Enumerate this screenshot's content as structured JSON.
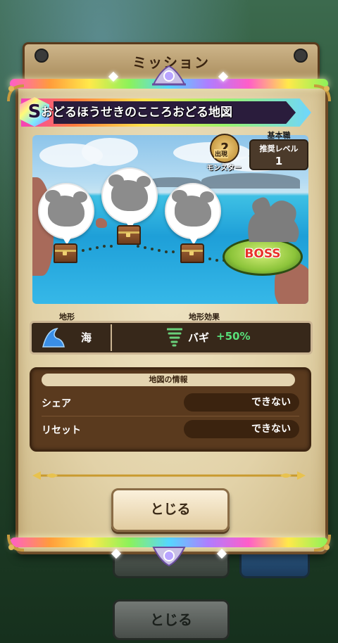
{
  "background": {
    "mission_title": "ミッション",
    "close_label": "とじる"
  },
  "title": {
    "rank": "S",
    "text": "おどるほうせきのこころおどる地図"
  },
  "map_meta": {
    "appear_icon": "?",
    "appear_line1": "出現",
    "appear_line2": "モンスター",
    "job_head": "基本職",
    "level_label": "推奨レベル",
    "level_value": "1",
    "boss_label": "BOSS"
  },
  "terrain": {
    "terrain_head": "地形",
    "effect_head": "地形効果",
    "terrain_icon": "wave-icon",
    "terrain_name": "海",
    "effect_icon": "tornado-icon",
    "effect_name": "バギ",
    "effect_value": "+50%"
  },
  "map_info": {
    "heading": "地図の情報",
    "rows": [
      {
        "label": "シェア",
        "value": "できない"
      },
      {
        "label": "リセット",
        "value": "できない"
      }
    ]
  },
  "actions": {
    "close_label": "とじる"
  },
  "colors": {
    "effect_value": "#58e07a",
    "boss_label": "#e8322a",
    "panel_border": "#6b4825"
  }
}
